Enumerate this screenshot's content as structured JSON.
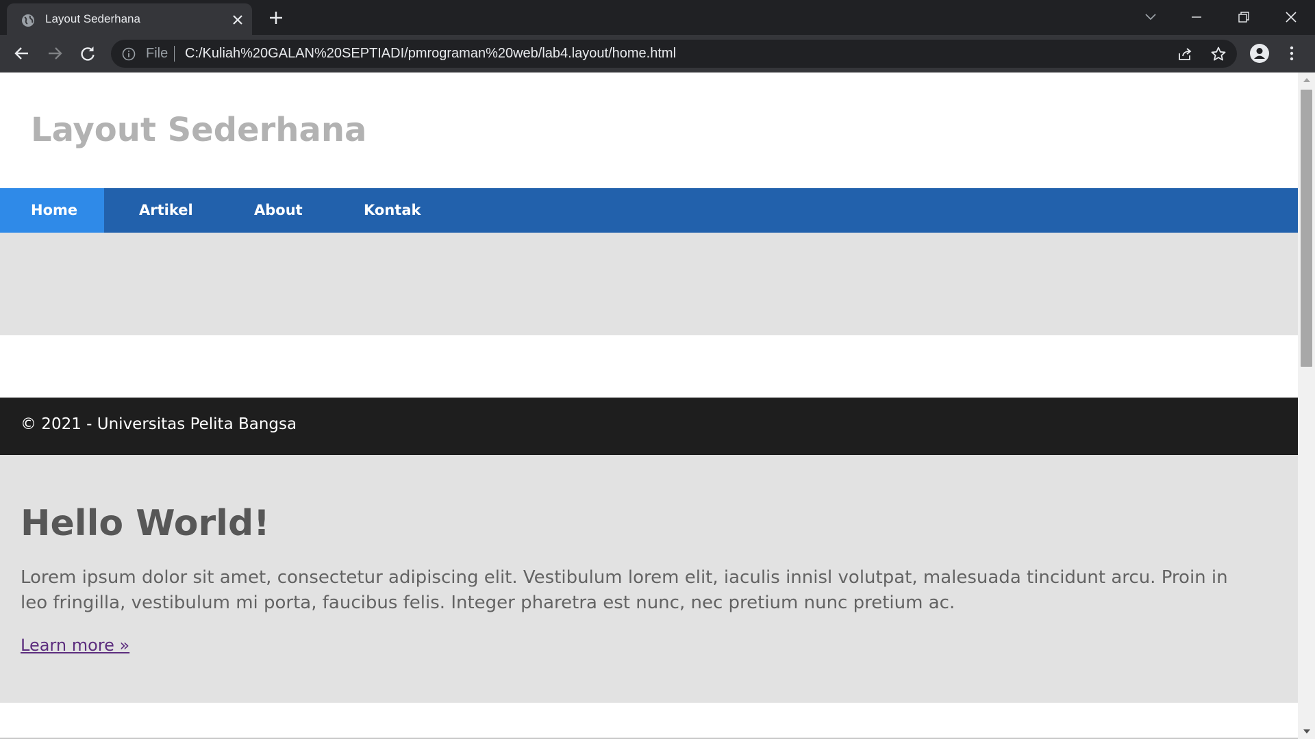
{
  "browser": {
    "tab_title": "Layout Sederhana",
    "omnibox": {
      "scheme_label": "File",
      "url": "C:/Kuliah%20GALAN%20SEPTIADI/pmrograman%20web/lab4.layout/home.html"
    },
    "icons": {
      "tab_favicon": "globe-icon",
      "tab_close": "close-icon",
      "new_tab": "plus-icon",
      "tab_search": "chevron-down-icon",
      "minimize": "minimize-icon",
      "restore": "restore-icon",
      "close_window": "close-icon",
      "back": "arrow-left-icon",
      "forward": "arrow-right-icon",
      "reload": "reload-icon",
      "site_info": "info-icon",
      "share": "share-icon",
      "bookmark": "star-icon",
      "profile": "person-icon",
      "menu": "kebab-menu-icon"
    }
  },
  "page": {
    "header": {
      "title": "Layout Sederhana"
    },
    "nav": {
      "items": [
        {
          "label": "Home",
          "active": true
        },
        {
          "label": "Artikel",
          "active": false
        },
        {
          "label": "About",
          "active": false
        },
        {
          "label": "Kontak",
          "active": false
        }
      ]
    },
    "footer": {
      "text": "© 2021 - Universitas Pelita Bangsa"
    },
    "jumbotron": {
      "title": "Hello World!",
      "text": "Lorem ipsum dolor sit amet, consectetur adipiscing elit. Vestibulum lorem elit, iaculis innisl volutpat, malesuada tincidunt arcu. Proin in leo fringilla, vestibulum mi porta, faucibus felis. Integer pharetra est nunc, nec pretium nunc pretium ac.",
      "link_label": "Learn more »"
    }
  },
  "colors": {
    "chrome_dark": "#202124",
    "chrome_toolbar": "#35363a",
    "nav_bar": "#2261ac",
    "nav_active": "#2f8ae8",
    "header_title": "#b2b2b2",
    "gray_band": "#e2e2e2",
    "footer_bg": "#1e1e1e",
    "link_visited": "#5c2d7e"
  }
}
